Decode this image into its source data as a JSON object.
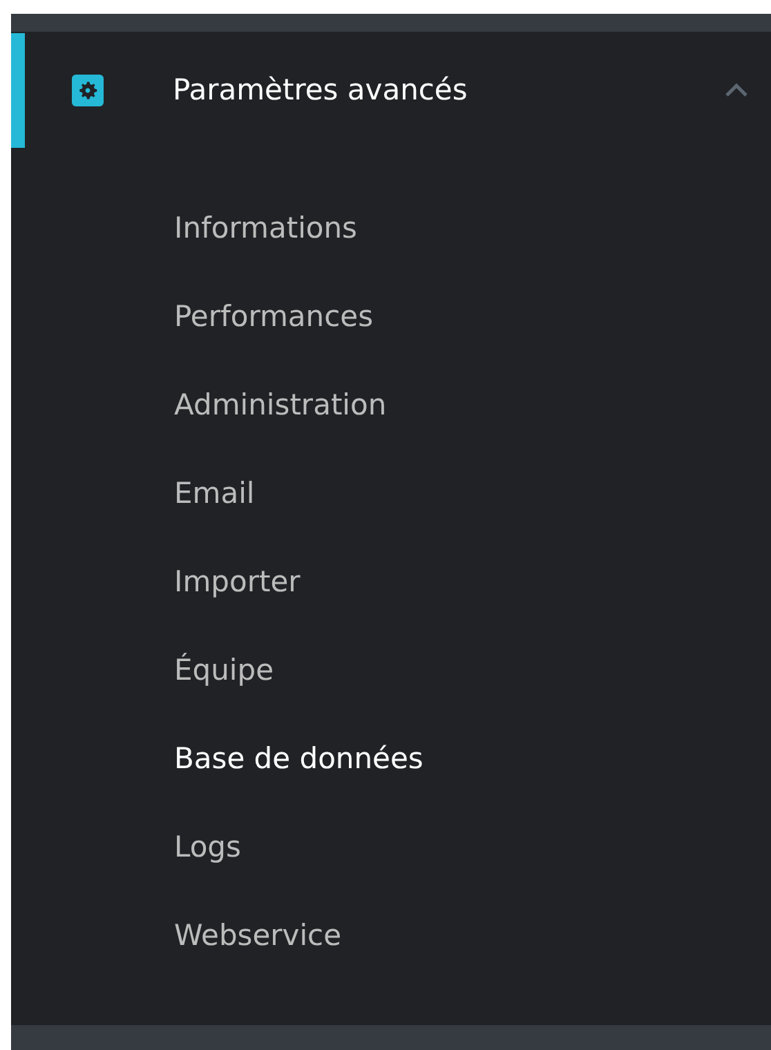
{
  "section": {
    "title": "Paramètres avancés",
    "active": true,
    "expanded": true,
    "items": [
      {
        "label": "Informations",
        "selected": false
      },
      {
        "label": "Performances",
        "selected": false
      },
      {
        "label": "Administration",
        "selected": false
      },
      {
        "label": "Email",
        "selected": false
      },
      {
        "label": "Importer",
        "selected": false
      },
      {
        "label": "Équipe",
        "selected": false
      },
      {
        "label": "Base de données",
        "selected": true
      },
      {
        "label": "Logs",
        "selected": false
      },
      {
        "label": "Webservice",
        "selected": false
      }
    ]
  }
}
